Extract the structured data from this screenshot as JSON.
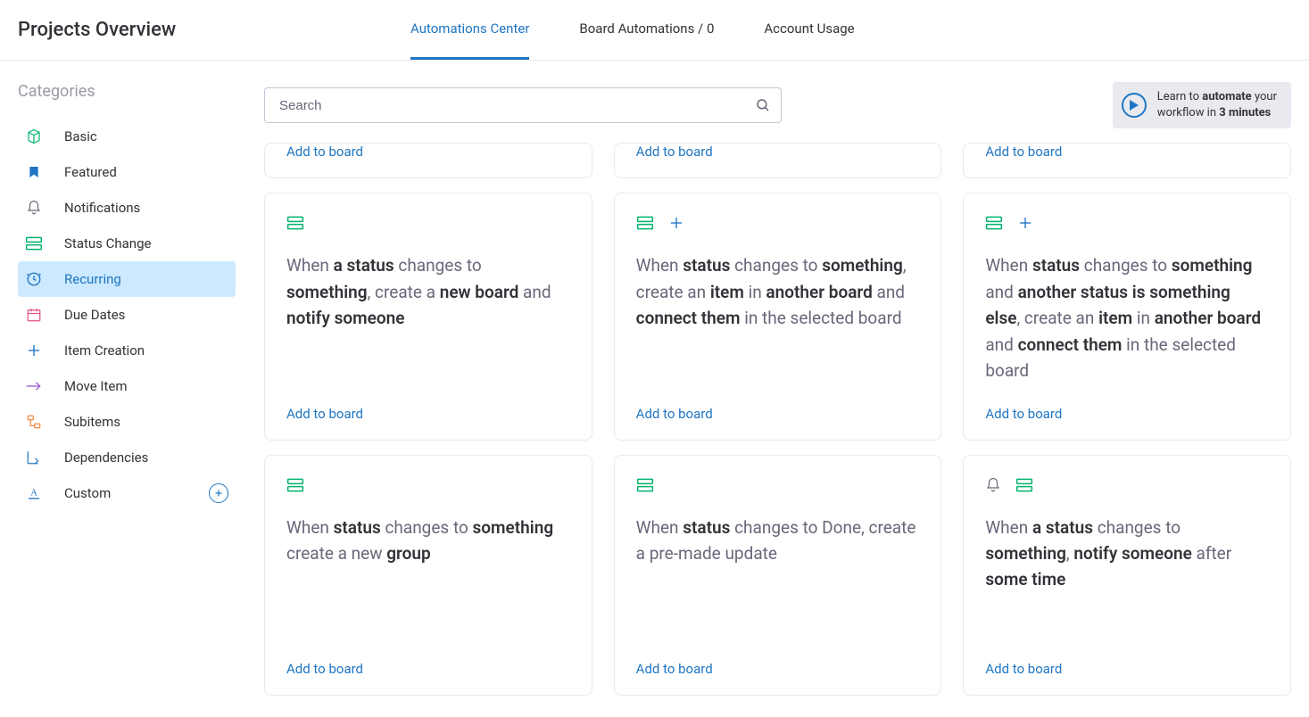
{
  "header": {
    "title": "Projects Overview",
    "tabs": [
      {
        "label": "Automations Center",
        "active": true
      },
      {
        "label": "Board Automations / 0",
        "active": false
      },
      {
        "label": "Account Usage",
        "active": false
      }
    ]
  },
  "sidebar": {
    "heading": "Categories",
    "items": [
      {
        "label": "Basic",
        "icon": "cube-icon",
        "color": "#00b36b"
      },
      {
        "label": "Featured",
        "icon": "bookmark-icon",
        "color": "#1f76c2"
      },
      {
        "label": "Notifications",
        "icon": "bell-icon",
        "color": "#676879"
      },
      {
        "label": "Status Change",
        "icon": "rows-icon",
        "color": "#00b36b"
      },
      {
        "label": "Recurring",
        "icon": "clock-icon",
        "color": "#f5a623",
        "selected": true
      },
      {
        "label": "Due Dates",
        "icon": "calendar-icon",
        "color": "#e24f7c"
      },
      {
        "label": "Item Creation",
        "icon": "plus-icon",
        "color": "#1f76c2"
      },
      {
        "label": "Move Item",
        "icon": "arrow-icon",
        "color": "#a25ddc"
      },
      {
        "label": "Subitems",
        "icon": "subitem-icon",
        "color": "#f08a42"
      },
      {
        "label": "Dependencies",
        "icon": "dep-icon",
        "color": "#1f76c2"
      },
      {
        "label": "Custom",
        "icon": "custom-icon",
        "color": "#1f76c2",
        "add": true
      }
    ]
  },
  "search": {
    "placeholder": "Search"
  },
  "learn": {
    "line1_pre": "Learn to ",
    "line1_bold": "automate",
    "line1_post": " your",
    "line2_pre": "workflow in ",
    "line2_bold": "3 minutes"
  },
  "cards": {
    "row0": [
      {
        "add": "Add to board"
      },
      {
        "add": "Add to board"
      },
      {
        "add": "Add to board"
      }
    ],
    "row1": [
      {
        "icons": [
          {
            "name": "rows-icon",
            "color": "#00b36b"
          }
        ],
        "segs": [
          "When ",
          "<b>a status</b>",
          " changes to ",
          "<b>something</b>",
          ", create a ",
          "<b>new board</b>",
          " and ",
          "<b>notify someone</b>"
        ],
        "add": "Add to board"
      },
      {
        "icons": [
          {
            "name": "rows-icon",
            "color": "#00b36b"
          },
          {
            "name": "plus-icon",
            "color": "#1f76c2"
          }
        ],
        "segs": [
          "When ",
          "<b>status</b>",
          " changes to ",
          "<b>something</b>",
          ", create an ",
          "<b>item</b>",
          " in ",
          "<b>another board</b>",
          " and ",
          "<b>connect them</b>",
          " in the selected board"
        ],
        "add": "Add to board"
      },
      {
        "icons": [
          {
            "name": "rows-icon",
            "color": "#00b36b"
          },
          {
            "name": "plus-icon",
            "color": "#1f76c2"
          }
        ],
        "segs": [
          "When ",
          "<b>status</b>",
          " changes to ",
          "<b>something</b>",
          " and ",
          "<b>another status</b>",
          " ",
          "<b>is something else</b>",
          ", create an ",
          "<b>item</b>",
          " in ",
          "<b>another board</b>",
          " and ",
          "<b>connect them</b>",
          " in the selected board"
        ],
        "add": "Add to board"
      }
    ],
    "row2": [
      {
        "icons": [
          {
            "name": "rows-icon",
            "color": "#00b36b"
          }
        ],
        "segs": [
          "When ",
          "<b>status</b>",
          " changes to ",
          "<b>something</b>",
          " create a new ",
          "<b>group</b>"
        ],
        "add": "Add to board"
      },
      {
        "icons": [
          {
            "name": "rows-icon",
            "color": "#00b36b"
          }
        ],
        "segs": [
          "When ",
          "<b>status</b>",
          " changes to Done, create a pre-made update"
        ],
        "add": "Add to board"
      },
      {
        "icons": [
          {
            "name": "bell-icon",
            "color": "#676879"
          },
          {
            "name": "rows-icon",
            "color": "#00b36b"
          }
        ],
        "segs": [
          "When ",
          "<b>a status</b>",
          " changes to ",
          "<b>something</b>",
          ", ",
          "<b>notify someone</b>",
          " after ",
          "<b>some time</b>"
        ],
        "add": "Add to board"
      }
    ]
  }
}
